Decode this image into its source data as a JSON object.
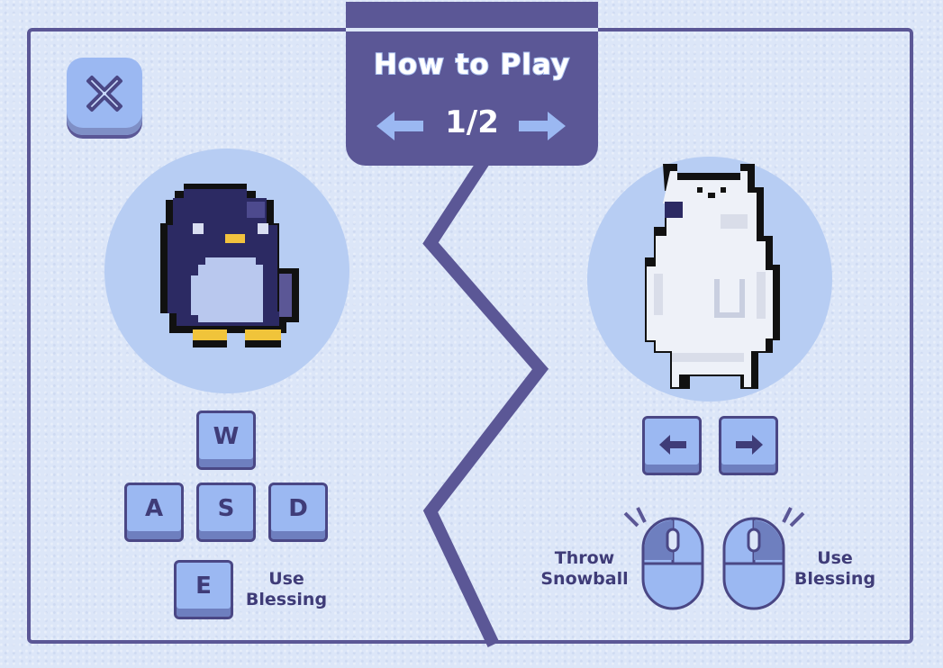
{
  "header": {
    "title": "How to Play",
    "page_indicator": "1/2"
  },
  "nav": {
    "prev_icon": "arrow-left-icon",
    "next_icon": "arrow-right-icon",
    "close_icon": "close-x-icon"
  },
  "player_one": {
    "character": "penguin",
    "keys": {
      "up": "W",
      "left": "A",
      "down": "S",
      "right": "D",
      "blessing": "E"
    },
    "blessing_label": "Use Blessing"
  },
  "player_two": {
    "character": "polar-bear",
    "keys": {
      "left_icon": "arrow-left-icon",
      "right_icon": "arrow-right-icon"
    },
    "left_click_label": "Throw Snowball",
    "right_click_label": "Use Blessing"
  },
  "colors": {
    "frame": "#5b5796",
    "key": "#9bb8f2",
    "circle": "#b7cdf3",
    "background": "#dce6f8"
  }
}
